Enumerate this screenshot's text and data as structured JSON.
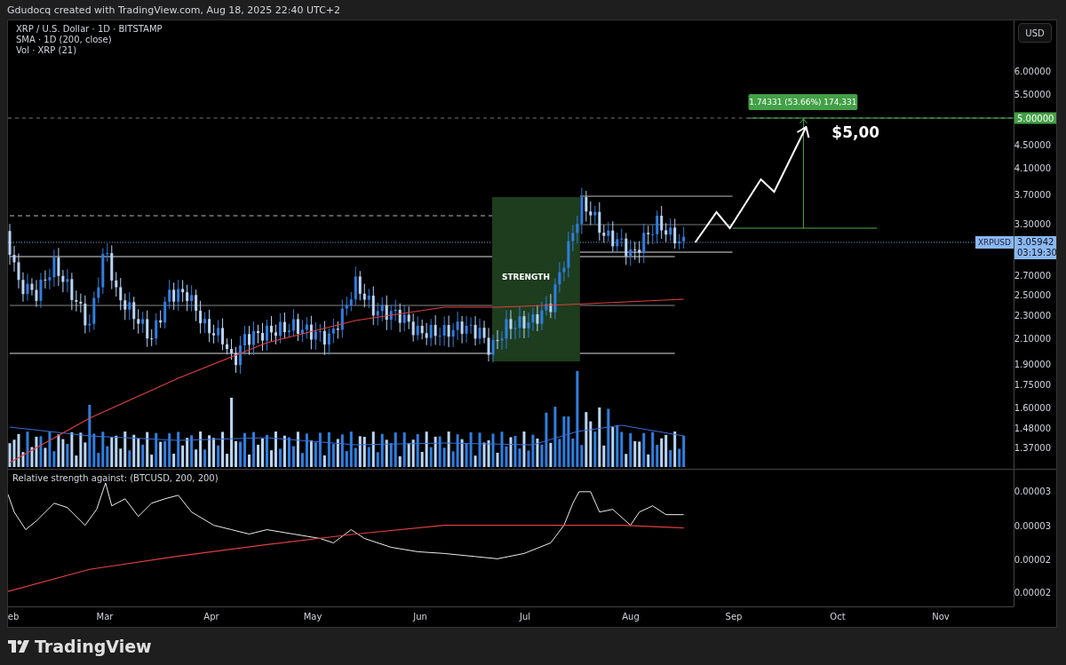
{
  "header": {
    "credit": "Gdudocq created with TradingView.com, Aug 18, 2025 22:40 UTC+2"
  },
  "legend": [
    "XRP / U.S. Dollar · 1D · BITSTAMP",
    "SMA · 1D (200, close)",
    "Vol · XRP (21)"
  ],
  "currency_button": "USD",
  "price_axis": [
    "6.00000",
    "5.50000",
    "4.50000",
    "4.10000",
    "3.70000",
    "3.30000",
    "2.70000",
    "2.50000",
    "2.30000",
    "2.10000",
    "1.90000",
    "1.75000",
    "1.60000",
    "1.48000",
    "1.37000"
  ],
  "target_price": "5.00000",
  "last_price": {
    "symbol": "XRPUSD",
    "price": "3.05942",
    "countdown": "03:19:30"
  },
  "annotations": {
    "box_label": "STRENGTH",
    "measure": "1.74331 (53.66%) 174,331",
    "target_text": "$5,00"
  },
  "rs_pane": {
    "title": "Relative strength against: (BTCUSD, 200, 200)",
    "axis": [
      "0.00003",
      "0.00003",
      "0.00002",
      "0.00002"
    ]
  },
  "time_axis": [
    "eb",
    "Mar",
    "Apr",
    "May",
    "Jun",
    "Jul",
    "Aug",
    "Sep",
    "Oct",
    "Nov"
  ],
  "footer": {
    "brand": "TradingView"
  }
}
